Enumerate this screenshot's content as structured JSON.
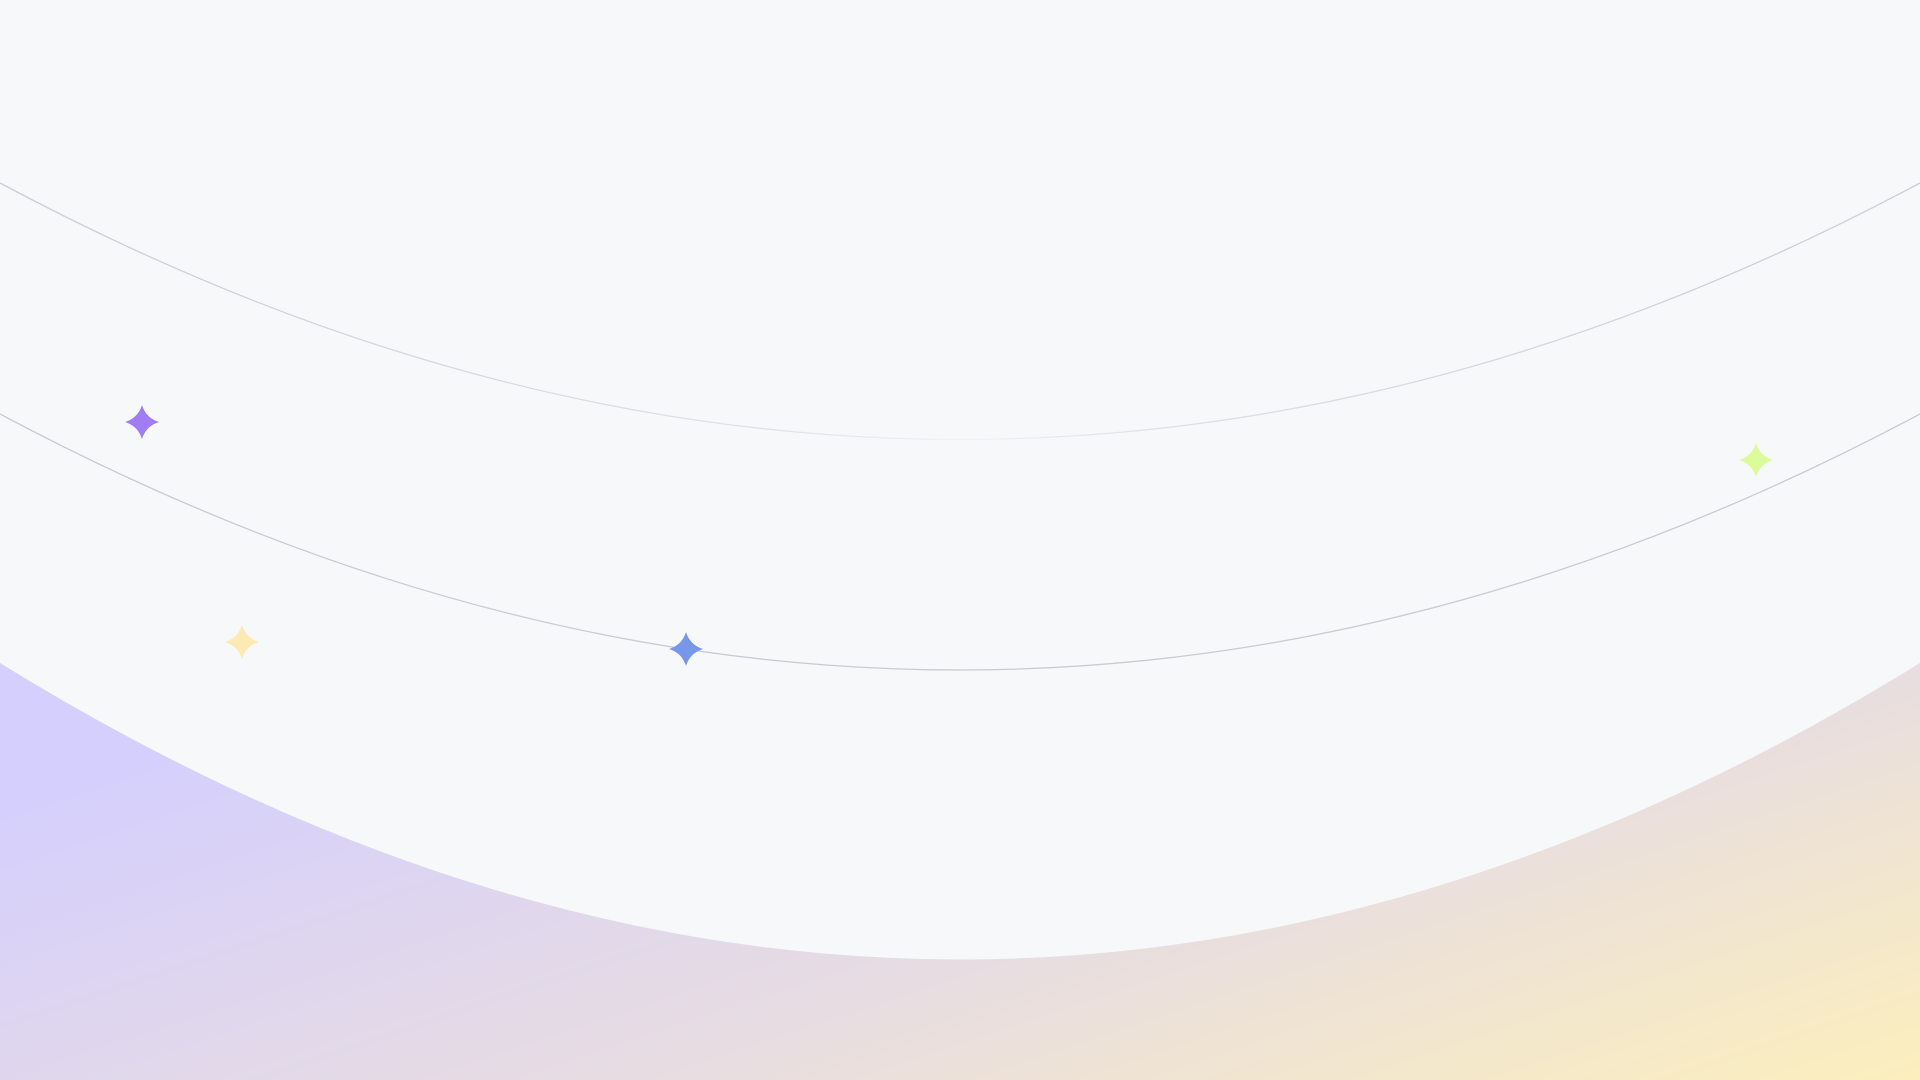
{
  "background": {
    "base_color": "#f7f8fa",
    "gradient_start": "#d5cffd",
    "gradient_mid": "#e8dde0",
    "gradient_end": "#fcefbd"
  },
  "arcs": {
    "line_color": "#c9cbd1"
  },
  "sparkles": [
    {
      "name": "sparkle-purple",
      "color": "#a07cf6"
    },
    {
      "name": "sparkle-blue",
      "color": "#7697ea"
    },
    {
      "name": "sparkle-yellow",
      "color": "#fdeab2"
    },
    {
      "name": "sparkle-green",
      "color": "#ddfb9a"
    }
  ]
}
